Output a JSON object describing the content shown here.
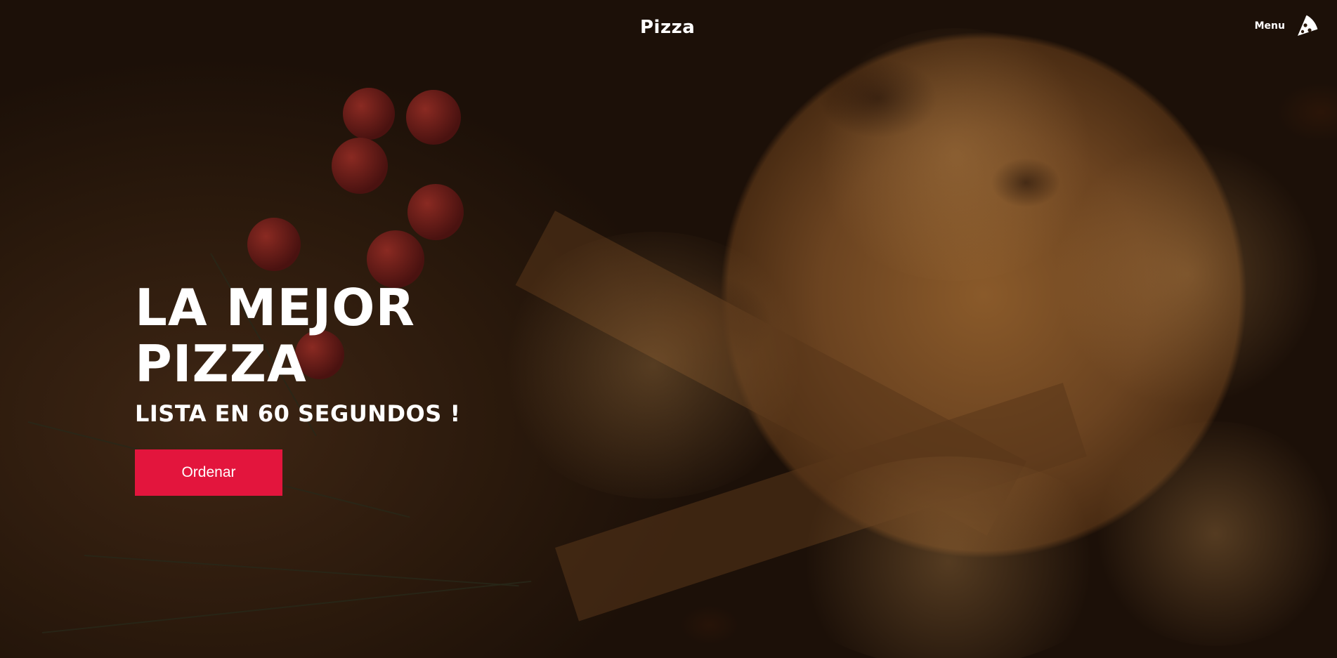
{
  "header": {
    "brand": "Pizza",
    "menu_label": "Menu",
    "menu_icon": "pizza-slice-icon"
  },
  "hero": {
    "headline_line1": "LA MEJOR",
    "headline_line2": "PIZZA",
    "subheadline": "LISTA EN 60 SEGUNDOS !",
    "cta_label": "Ordenar"
  },
  "colors": {
    "accent": "#e3153d",
    "text": "#ffffff"
  }
}
